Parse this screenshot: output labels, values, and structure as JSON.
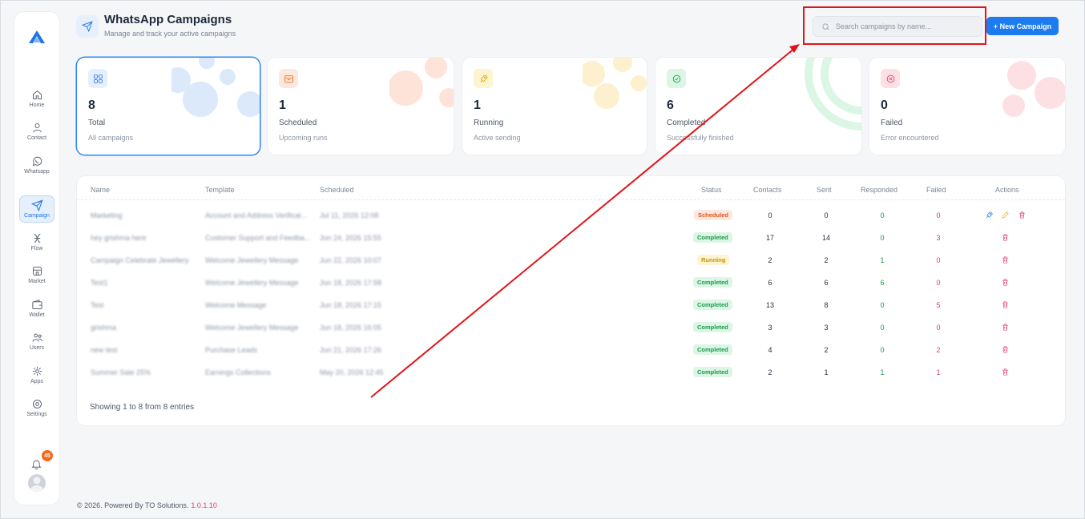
{
  "sidebar": {
    "items": [
      {
        "label": "Home",
        "icon": "home-icon"
      },
      {
        "label": "Contact",
        "icon": "user-icon"
      },
      {
        "label": "Whatsapp",
        "icon": "whatsapp-icon"
      },
      {
        "label": "Campaign",
        "icon": "send-icon",
        "active": true
      },
      {
        "label": "Flow",
        "icon": "flow-icon"
      },
      {
        "label": "Market",
        "icon": "market-icon"
      },
      {
        "label": "Wallet",
        "icon": "wallet-icon"
      },
      {
        "label": "Users",
        "icon": "users-icon"
      },
      {
        "label": "Apps",
        "icon": "apps-icon"
      },
      {
        "label": "Settings",
        "icon": "settings-icon"
      }
    ],
    "notifications": "45"
  },
  "header": {
    "title": "WhatsApp Campaigns",
    "subtitle": "Manage and track your active campaigns",
    "search_placeholder": "Search campaigns by name...",
    "new_button": "+ New Campaign"
  },
  "stats": [
    {
      "value": "8",
      "title": "Total",
      "desc": "All campaigns",
      "color": "#1d75e8"
    },
    {
      "value": "1",
      "title": "Scheduled",
      "desc": "Upcoming runs",
      "color": "#f26b1d"
    },
    {
      "value": "1",
      "title": "Running",
      "desc": "Active sending",
      "color": "#e3a908"
    },
    {
      "value": "6",
      "title": "Completed",
      "desc": "Successfully finished",
      "color": "#1b9a4b"
    },
    {
      "value": "0",
      "title": "Failed",
      "desc": "Error encountered",
      "color": "#e53a6c"
    }
  ],
  "table": {
    "columns": [
      "Name",
      "Template",
      "Scheduled",
      "Status",
      "Contacts",
      "Sent",
      "Responded",
      "Failed",
      "Actions"
    ],
    "rows": [
      {
        "name": "Marketing",
        "template": "Account and Address Verificat...",
        "scheduled": "Jul 11, 2026 12:08",
        "status": "Scheduled",
        "contacts": "0",
        "sent": "0",
        "responded": "0",
        "failed": "0"
      },
      {
        "name": "hey grishma here",
        "template": "Customer Support and Feedba...",
        "scheduled": "Jun 24, 2026 15:55",
        "status": "Completed",
        "contacts": "17",
        "sent": "14",
        "responded": "0",
        "failed": "3"
      },
      {
        "name": "Campaign Celebrate Jewellery",
        "template": "Welcome Jewellery Message",
        "scheduled": "Jun 22, 2026 10:07",
        "status": "Running",
        "contacts": "2",
        "sent": "2",
        "responded": "1",
        "failed": "0"
      },
      {
        "name": "Test1",
        "template": "Welcome Jewellery Message",
        "scheduled": "Jun 18, 2026 17:58",
        "status": "Completed",
        "contacts": "6",
        "sent": "6",
        "responded": "6",
        "failed": "0"
      },
      {
        "name": "Test",
        "template": "Welcome Message",
        "scheduled": "Jun 18, 2026 17:15",
        "status": "Completed",
        "contacts": "13",
        "sent": "8",
        "responded": "0",
        "failed": "5"
      },
      {
        "name": "grishma",
        "template": "Welcome Jewellery Message",
        "scheduled": "Jun 18, 2026 16:05",
        "status": "Completed",
        "contacts": "3",
        "sent": "3",
        "responded": "0",
        "failed": "0"
      },
      {
        "name": "new test",
        "template": "Purchase Leads",
        "scheduled": "Jun 21, 2026 17:26",
        "status": "Completed",
        "contacts": "4",
        "sent": "2",
        "responded": "0",
        "failed": "2"
      },
      {
        "name": "Summer Sale 25%",
        "template": "Earnings Collections",
        "scheduled": "May 20, 2026 12:45",
        "status": "Completed",
        "contacts": "2",
        "sent": "1",
        "responded": "1",
        "failed": "1"
      }
    ],
    "footer": "Showing 1 to 8 from 8 entries"
  },
  "footer": {
    "copyright": "© 2026. Powered By TO Solutions.",
    "version": "1.0.1.10"
  },
  "colors": {
    "primary": "#1d7bf0",
    "annotation": "#e0141a",
    "responded": "#1b9a4b",
    "failed": "#e53a6c"
  }
}
